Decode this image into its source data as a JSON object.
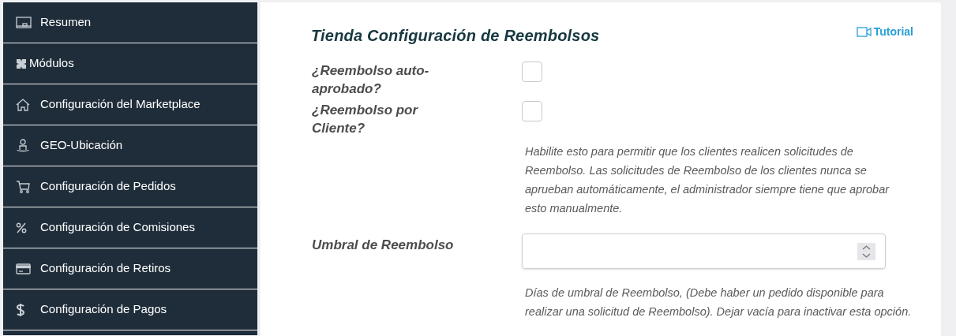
{
  "sidebar": {
    "items": [
      {
        "label": "Resumen"
      },
      {
        "label": "Módulos"
      },
      {
        "label": "Configuración del Marketplace"
      },
      {
        "label": "GEO-Ubicación"
      },
      {
        "label": "Configuración de Pedidos"
      },
      {
        "label": "Configuración de Comisiones"
      },
      {
        "label": "Configuración de Retiros"
      },
      {
        "label": "Configuración de Pagos"
      }
    ]
  },
  "panel": {
    "title": "Tienda Configuración de Reembolsos",
    "tutorial_link": "Tutorial",
    "fields": [
      {
        "kind": "checkbox",
        "label": "¿Reembolso auto-aprobado?",
        "checked": false
      },
      {
        "kind": "checkbox",
        "label": "¿Reembolso por Cliente?",
        "checked": false,
        "help": "Habilite esto para permitir que los clientes realicen solicitudes de Reembolso. Las solicitudes de Reembolso de los clientes nunca se aprueban automáticamente, el administrador siempre tiene que aprobar esto manualmente."
      },
      {
        "kind": "number",
        "label": "Umbral de Reembolso",
        "help": "Días de umbral de Reembolso, (Debe haber un pedido disponible para realizar una solicitud de Reembolso). Dejar vacía para inactivar esta opción."
      }
    ]
  }
}
